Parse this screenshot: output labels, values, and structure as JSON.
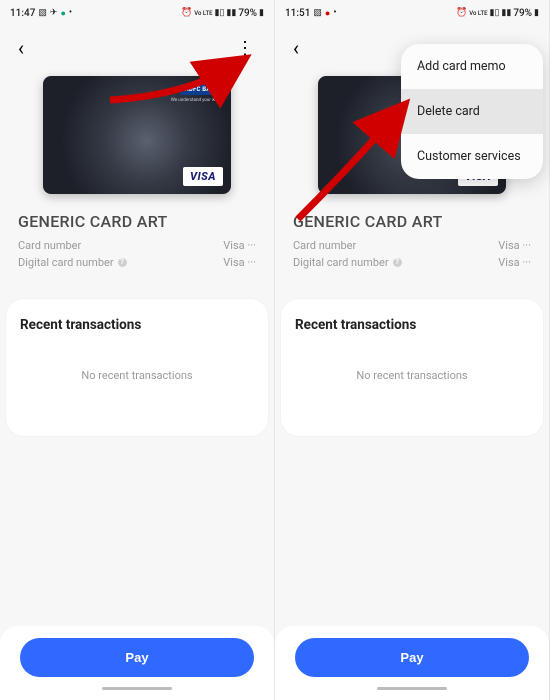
{
  "status": {
    "time_left": "11:47",
    "time_right": "11:51",
    "battery": "79%",
    "network": "Vo LTE"
  },
  "card": {
    "bank": "HDFC BANK",
    "bank_tag": "We understand your world",
    "brand": "VISA",
    "title": "GENERIC CARD ART",
    "number_label": "Card number",
    "number_value": "Visa ···",
    "digital_label": "Digital card number",
    "digital_value": "Visa ···"
  },
  "section": {
    "recent_title": "Recent transactions",
    "empty_msg": "No recent transactions"
  },
  "actions": {
    "pay": "Pay"
  },
  "menu": {
    "items": [
      "Add card memo",
      "Delete card",
      "Customer services"
    ]
  }
}
